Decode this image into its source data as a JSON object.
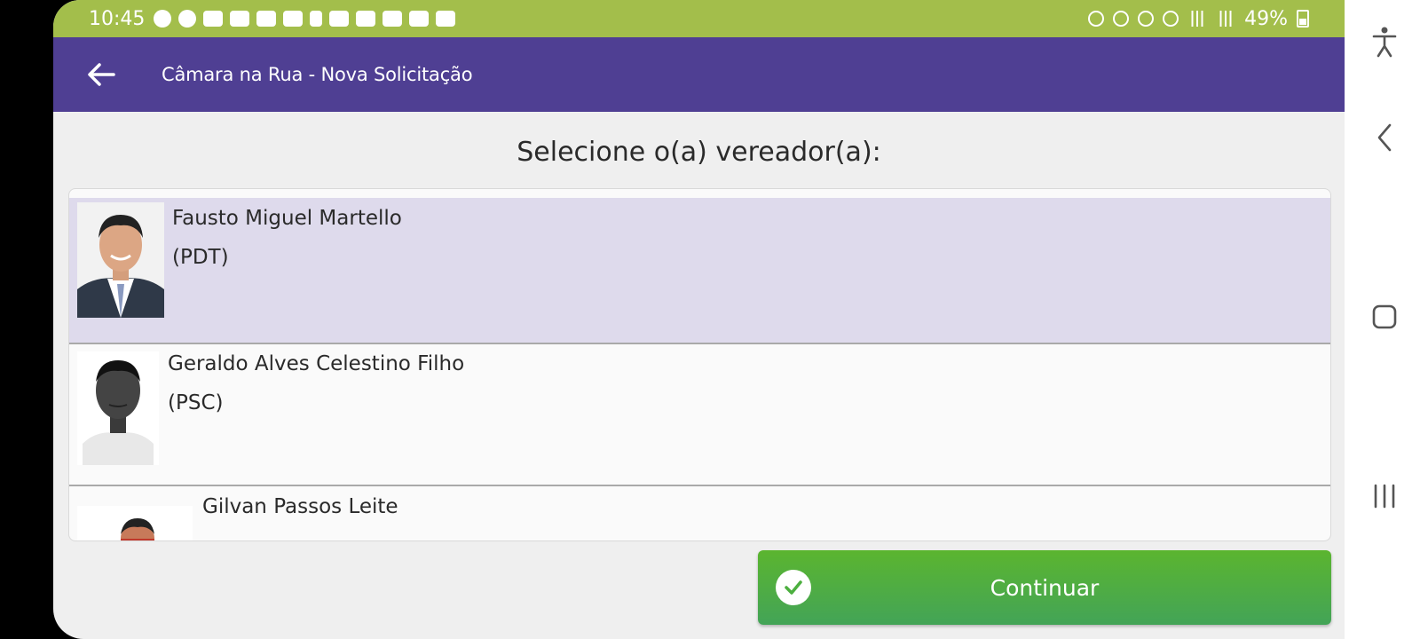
{
  "status_bar": {
    "time": "10:45",
    "battery": "49%",
    "background": "#a3be4b"
  },
  "app_bar": {
    "title": "Câmara na Rua - Nova Solicitação",
    "back_icon": "arrow-left-icon",
    "background": "#4f3f93"
  },
  "prompt": "Selecione o(a) vereador(a):",
  "councilors": [
    {
      "name": "Fausto Miguel Martello",
      "party": "(PDT)",
      "selected": true
    },
    {
      "name": "Geraldo Alves Celestino Filho",
      "party": "(PSC)",
      "selected": false
    },
    {
      "name": "Gilvan Passos Leite",
      "party": "",
      "selected": false
    }
  ],
  "continue_button": {
    "label": "Continuar",
    "icon": "check-circle-icon",
    "color": "#4caf3f"
  },
  "system_nav": {
    "accessibility_icon": "accessibility-icon",
    "back_icon": "chevron-left-icon",
    "home_icon": "square-icon",
    "recents_icon": "recents-icon"
  },
  "colors": {
    "selected_row": "#dedaec",
    "accent": "#4f3f93"
  }
}
